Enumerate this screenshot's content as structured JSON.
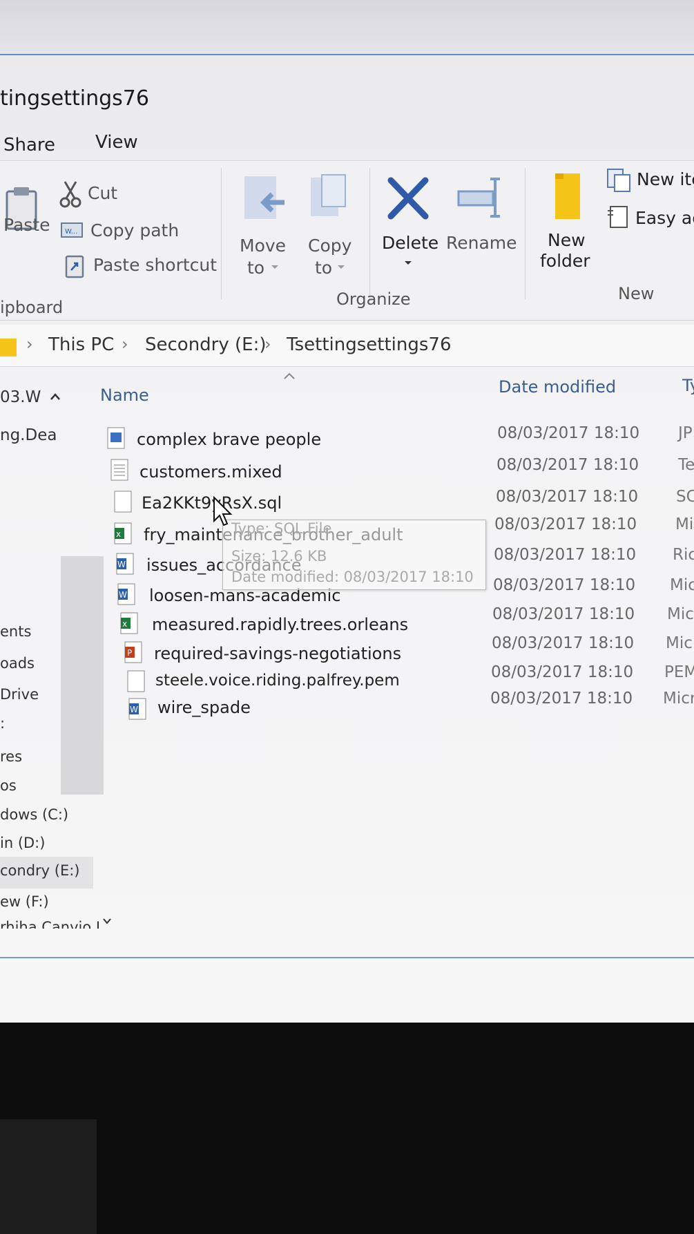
{
  "window": {
    "title": "tingsettings76"
  },
  "ribbon_tabs": [
    "Share",
    "View"
  ],
  "clipboard": {
    "paste": "Paste",
    "cut": "Cut",
    "copy_path": "Copy path",
    "paste_shortcut": "Paste shortcut",
    "group_label": "ipboard"
  },
  "organize": {
    "move_to_line1": "Move",
    "move_to_line2": "to",
    "copy_to_line1": "Copy",
    "copy_to_line2": "to",
    "delete": "Delete",
    "rename": "Rename",
    "group_label": "Organize"
  },
  "new_group": {
    "new_folder_line1": "New",
    "new_folder_line2": "folder",
    "new_item": "New ite",
    "easy_access": "Easy ac",
    "group_label": "New"
  },
  "address": {
    "crumbs": [
      "This PC",
      "Secondry (E:)",
      "Tsettingsettings76"
    ]
  },
  "columns": {
    "name": "Name",
    "date": "Date modified",
    "type": "Ty"
  },
  "nav": {
    "top_item": "03.W",
    "items": [
      "ng.Dea",
      "ents",
      "oads",
      "Drive",
      ":",
      "res",
      "os",
      "dows (C:)",
      "in (D:)",
      "condry (E:)",
      "ew (F:)",
      "rhiha Canvio I"
    ]
  },
  "files": [
    {
      "name": "complex brave people",
      "date": "08/03/2017 18:10",
      "type": "JP",
      "icon": "image-file-icon"
    },
    {
      "name": "customers.mixed",
      "date": "08/03/2017 18:10",
      "type": "Te",
      "icon": "text-file-icon"
    },
    {
      "name": "Ea2KKt9yRsX.sql",
      "date": "08/03/2017 18:10",
      "type": "SC",
      "icon": "blank-file-icon"
    },
    {
      "name": "fry_maintenance_brother_adult",
      "date": "08/03/2017 18:10",
      "type": "Mi",
      "icon": "excel-file-icon"
    },
    {
      "name": "issues_accordance",
      "date": "08/03/2017 18:10",
      "type": "Ric",
      "icon": "word-file-icon"
    },
    {
      "name": "loosen-mans-academic",
      "date": "08/03/2017 18:10",
      "type": "Mic",
      "icon": "word-file-icon"
    },
    {
      "name": "measured.rapidly.trees.orleans",
      "date": "08/03/2017 18:10",
      "type": "Mic",
      "icon": "excel-file-icon"
    },
    {
      "name": "required-savings-negotiations",
      "date": "08/03/2017 18:10",
      "type": "Mic",
      "icon": "powerpoint-file-icon"
    },
    {
      "name": "steele.voice.riding.palfrey.pem",
      "date": "08/03/2017 18:10",
      "type": "PEM",
      "icon": "blank-file-icon"
    },
    {
      "name": "wire_spade",
      "date": "08/03/2017 18:10",
      "type": "Micr",
      "icon": "word-file-icon"
    }
  ],
  "tooltip": {
    "type_line": "Type: SQL File",
    "size_line": "Size: 12.6 KB",
    "date_line": "Date modified: 08/03/2017 18:10"
  }
}
